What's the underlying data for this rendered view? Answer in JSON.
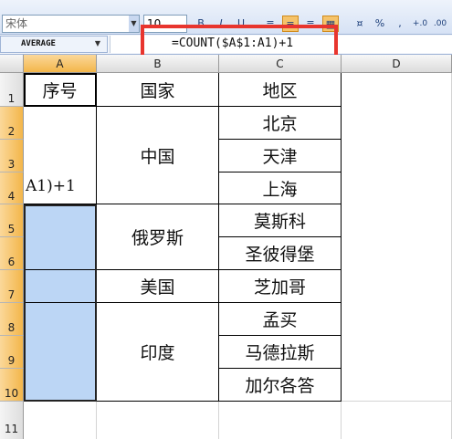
{
  "toolbar": {
    "font_name": "宋体",
    "font_size": "10"
  },
  "formula_bar": {
    "name_box": "AVERAGE",
    "formula": "=COUNT($A$1:A1)+1"
  },
  "columns": [
    "A",
    "B",
    "C",
    "D"
  ],
  "rows": [
    "1",
    "2",
    "3",
    "4",
    "5",
    "6",
    "7",
    "8",
    "9",
    "10",
    "11"
  ],
  "cells": {
    "a1": "序号",
    "a_edit": "A1)+1",
    "b_header": "国家",
    "c_header": "地区",
    "countries": [
      "中国",
      "俄罗斯",
      "美国",
      "印度"
    ],
    "regions": [
      "北京",
      "天津",
      "上海",
      "莫斯科",
      "圣彼得堡",
      "芝加哥",
      "孟买",
      "马德拉斯",
      "加尔各答"
    ]
  },
  "colors": {
    "highlight_box": "#e8352e",
    "selection_fill": "#bcd6f5",
    "header_selected": "#f3b64a"
  }
}
